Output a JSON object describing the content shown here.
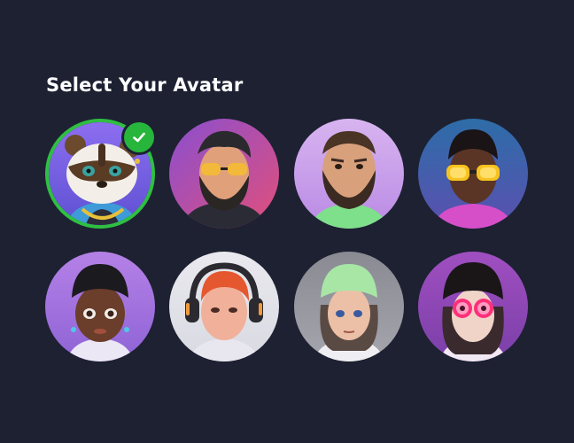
{
  "page": {
    "title": "Select Your Avatar"
  },
  "colors": {
    "background": "#1d2132",
    "selected_ring": "#2fbf42",
    "check_badge": "#27b53b"
  },
  "avatars": [
    {
      "name": "raccoon-rapper",
      "selected": true
    },
    {
      "name": "bearded-man-yellow-glasses",
      "selected": false
    },
    {
      "name": "bearded-man-green-shirt",
      "selected": false
    },
    {
      "name": "man-yellow-goggles",
      "selected": false
    },
    {
      "name": "girl-black-beanie-earrings",
      "selected": false
    },
    {
      "name": "girl-headphones",
      "selected": false
    },
    {
      "name": "girl-green-beanie",
      "selected": false
    },
    {
      "name": "girl-neon-goggles",
      "selected": false
    }
  ],
  "icons": {
    "selected_badge": "checkmark-icon"
  }
}
